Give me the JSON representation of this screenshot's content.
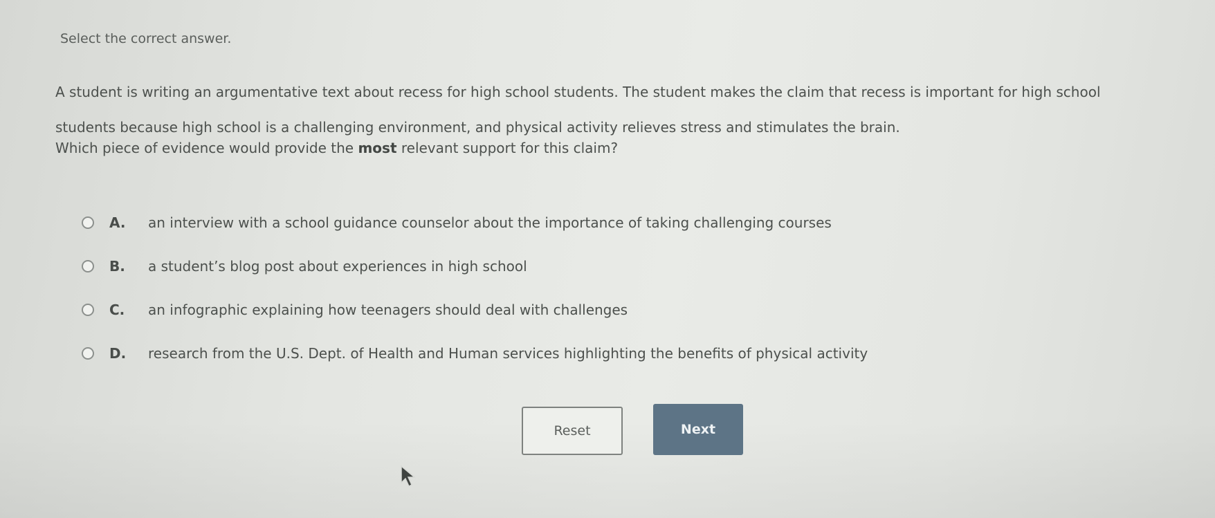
{
  "prompt": "Select the correct answer.",
  "question": {
    "line1": "A student is writing an argumentative text about recess for high school students. The student makes the claim that recess is important for high school",
    "line2": "students because high school is a challenging environment, and physical activity relieves stress and stimulates the brain."
  },
  "ask": {
    "before": "Which piece of evidence would provide the ",
    "emphasis": "most",
    "after": " relevant support for this claim?"
  },
  "options": [
    {
      "letter": "A.",
      "text": "an interview with a school guidance counselor about the importance of taking challenging courses"
    },
    {
      "letter": "B.",
      "text": "a student’s blog post about experiences in high school"
    },
    {
      "letter": "C.",
      "text": "an infographic explaining how teenagers should deal with challenges"
    },
    {
      "letter": "D.",
      "text": "research from the U.S. Dept. of Health and Human services highlighting the benefits of physical activity"
    }
  ],
  "buttons": {
    "reset": "Reset",
    "next": "Next"
  },
  "icons": {
    "cursor": "mouse-pointer-icon",
    "radio": "radio-unchecked-icon"
  },
  "colors": {
    "next_button": "#5d7486",
    "background": "#e6e8e4"
  }
}
